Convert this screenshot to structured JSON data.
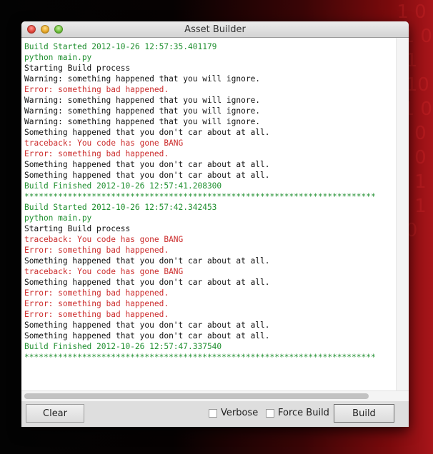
{
  "window": {
    "title": "Asset Builder"
  },
  "colors": {
    "info": "#1f8f2f",
    "normal": "#111111",
    "error": "#cc2d2d"
  },
  "console_lines": [
    {
      "type": "info",
      "text": "Build Started 2012-10-26 12:57:35.401179"
    },
    {
      "type": "info",
      "text": "python main.py"
    },
    {
      "type": "normal",
      "text": "Starting Build process"
    },
    {
      "type": "normal",
      "text": "Warning: something happened that you will ignore."
    },
    {
      "type": "error",
      "text": "Error: something bad happened."
    },
    {
      "type": "normal",
      "text": "Warning: something happened that you will ignore."
    },
    {
      "type": "normal",
      "text": "Warning: something happened that you will ignore."
    },
    {
      "type": "normal",
      "text": "Warning: something happened that you will ignore."
    },
    {
      "type": "normal",
      "text": "Something happened that you don't car about at all."
    },
    {
      "type": "error",
      "text": "traceback: You code has gone BANG"
    },
    {
      "type": "error",
      "text": "Error: something bad happened."
    },
    {
      "type": "normal",
      "text": "Something happened that you don't car about at all."
    },
    {
      "type": "normal",
      "text": "Something happened that you don't car about at all."
    },
    {
      "type": "info",
      "text": "Build Finished 2012-10-26 12:57:41.208300"
    },
    {
      "type": "info",
      "text": "*************************************************************************"
    },
    {
      "type": "info",
      "text": "Build Started 2012-10-26 12:57:42.342453"
    },
    {
      "type": "info",
      "text": "python main.py"
    },
    {
      "type": "normal",
      "text": "Starting Build process"
    },
    {
      "type": "error",
      "text": "traceback: You code has gone BANG"
    },
    {
      "type": "error",
      "text": "Error: something bad happened."
    },
    {
      "type": "normal",
      "text": "Something happened that you don't car about at all."
    },
    {
      "type": "error",
      "text": "traceback: You code has gone BANG"
    },
    {
      "type": "normal",
      "text": "Something happened that you don't car about at all."
    },
    {
      "type": "error",
      "text": "Error: something bad happened."
    },
    {
      "type": "error",
      "text": "Error: something bad happened."
    },
    {
      "type": "error",
      "text": "Error: something bad happened."
    },
    {
      "type": "normal",
      "text": "Something happened that you don't car about at all."
    },
    {
      "type": "normal",
      "text": "Something happened that you don't car about at all."
    },
    {
      "type": "info",
      "text": "Build Finished 2012-10-26 12:57:47.337540"
    },
    {
      "type": "info",
      "text": "*************************************************************************"
    }
  ],
  "toolbar": {
    "clear_label": "Clear",
    "verbose_label": "Verbose",
    "verbose_checked": false,
    "force_build_label": "Force Build",
    "force_build_checked": false,
    "build_label": "Build"
  },
  "background": {
    "digits": "1 0 01 0 1 010 01 0 1 0 1 0 0 1 0 1 0"
  }
}
